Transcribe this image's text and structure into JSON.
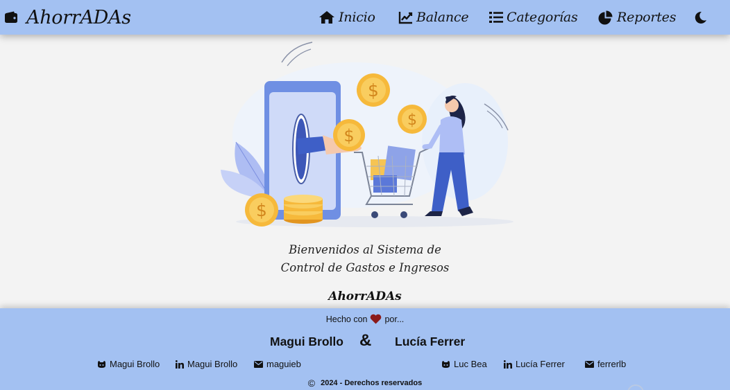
{
  "app": {
    "brand": "AhorrADAs",
    "brand_icon": "wallet-icon"
  },
  "nav": {
    "items": [
      {
        "label": "Inicio",
        "icon": "home-icon"
      },
      {
        "label": "Balance",
        "icon": "chart-line-icon"
      },
      {
        "label": "Categorías",
        "icon": "list-icon"
      },
      {
        "label": "Reportes",
        "icon": "pie-chart-icon"
      }
    ],
    "theme_toggle_icon": "moon-icon"
  },
  "hero": {
    "welcome_line1": "Bienvenidos al Sistema de",
    "welcome_line2": "Control de Gastos e Ingresos",
    "app_name": "AhorrADAs"
  },
  "footer": {
    "made_with_prefix": "Hecho con",
    "made_with_suffix": "por...",
    "heart_color": "#8b1a1a",
    "author1": "Magui Brollo",
    "ampersand": "&",
    "author2": "Lucía Ferrer",
    "author1_links": [
      {
        "icon": "github-icon",
        "label": "Magui Brollo"
      },
      {
        "icon": "linkedin-icon",
        "label": "Magui Brollo"
      },
      {
        "icon": "envelope-icon",
        "label": "maguieb"
      }
    ],
    "author2_links": [
      {
        "icon": "github-icon",
        "label": "Luc Bea"
      },
      {
        "icon": "linkedin-icon",
        "label": "Lucía Ferrer"
      },
      {
        "icon": "envelope-icon",
        "label": "ferrerlb"
      }
    ],
    "copyright_symbol": "©",
    "copyright_text": "2024 - Derechos reservados"
  },
  "colors": {
    "navbar_bg": "#a3c1f2",
    "page_bg": "#f3f3f3",
    "coin": "#f6b93b",
    "phone": "#6f8fe3"
  }
}
